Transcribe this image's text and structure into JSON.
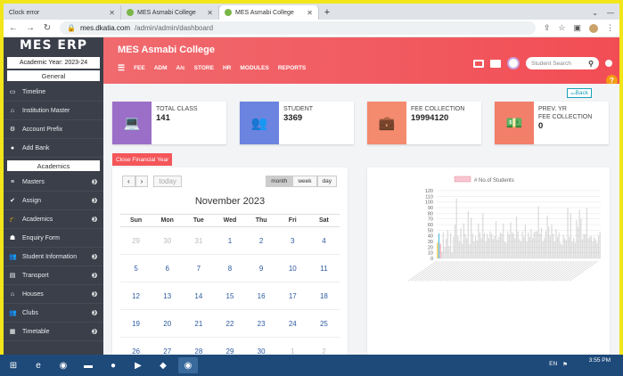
{
  "browser": {
    "tabs": [
      {
        "label": "Clock error",
        "active": false
      },
      {
        "label": "MES Asmabi College",
        "active": false
      },
      {
        "label": "MES Asmabi College",
        "active": true
      }
    ],
    "url_host": "mes.dkatia.com",
    "url_path": "/admin/admin/dashboard"
  },
  "sidebar": {
    "brand": "MES ERP",
    "academic_year": "Academic Year: 2023-24",
    "general_header": "General",
    "general_items": [
      {
        "label": "Timeline",
        "icon": "monitor-icon",
        "arrow": false
      },
      {
        "label": "Institution Master",
        "icon": "bank-icon",
        "arrow": false
      },
      {
        "label": "Account Prefix",
        "icon": "gears-icon",
        "arrow": false
      },
      {
        "label": "Add Bank",
        "icon": "dot-icon",
        "arrow": false
      }
    ],
    "academics_header": "Academics",
    "academics_items": [
      {
        "label": "Masters",
        "icon": "list-icon",
        "arrow": true
      },
      {
        "label": "Assign",
        "icon": "check-icon",
        "arrow": true
      },
      {
        "label": "Academics",
        "icon": "graduation-icon",
        "arrow": true
      },
      {
        "label": "Enquiry Form",
        "icon": "user-icon",
        "arrow": false
      },
      {
        "label": "Student Information",
        "icon": "users-icon",
        "arrow": true
      },
      {
        "label": "Transport",
        "icon": "bus-icon",
        "arrow": true
      },
      {
        "label": "Houses",
        "icon": "home-icon",
        "arrow": true
      },
      {
        "label": "Clubs",
        "icon": "users-icon",
        "arrow": true
      },
      {
        "label": "Timetable",
        "icon": "table-icon",
        "arrow": true
      }
    ]
  },
  "header": {
    "title": "MES Asmabi College",
    "menu": [
      "FEE",
      "ADM",
      "A/c",
      "STORE",
      "HR",
      "MODULES",
      "REPORTS"
    ],
    "search_placeholder": "Student Search"
  },
  "back_label": "Back",
  "cards": [
    {
      "label": "TOTAL CLASS",
      "value": "141",
      "color": "#9b6fc8",
      "icon": "laptop-icon"
    },
    {
      "label": "STUDENT",
      "value": "3369",
      "color": "#6b84e0",
      "icon": "users-icon"
    },
    {
      "label": "FEE COLLECTION",
      "value": "19994120",
      "color": "#f48a6e",
      "icon": "briefcase-icon"
    },
    {
      "label": "PREV. YR",
      "label2": "FEE COLLECTION",
      "value": "0",
      "color": "#f27f6a",
      "icon": "money-icon"
    }
  ],
  "close_fy": "Close Financial Year",
  "calendar": {
    "prev": "‹",
    "next": "›",
    "today": "today",
    "views": [
      "month",
      "week",
      "day"
    ],
    "title": "November 2023",
    "daynames": [
      "Sun",
      "Mon",
      "Tue",
      "Wed",
      "Thu",
      "Fri",
      "Sat"
    ],
    "days": [
      [
        "29",
        1
      ],
      [
        "30",
        1
      ],
      [
        "31",
        1
      ],
      [
        "1",
        0
      ],
      [
        "2",
        0
      ],
      [
        "3",
        0
      ],
      [
        "4",
        0
      ],
      [
        "5",
        0
      ],
      [
        "6",
        0
      ],
      [
        "7",
        0
      ],
      [
        "8",
        0
      ],
      [
        "9",
        0
      ],
      [
        "10",
        0
      ],
      [
        "11",
        0
      ],
      [
        "12",
        0
      ],
      [
        "13",
        0
      ],
      [
        "14",
        0
      ],
      [
        "15",
        0
      ],
      [
        "16",
        0
      ],
      [
        "17",
        0
      ],
      [
        "18",
        0
      ],
      [
        "19",
        0
      ],
      [
        "20",
        0
      ],
      [
        "21",
        0
      ],
      [
        "22",
        0
      ],
      [
        "23",
        0
      ],
      [
        "24",
        0
      ],
      [
        "25",
        0
      ],
      [
        "26",
        0
      ],
      [
        "27",
        0
      ],
      [
        "28",
        0
      ],
      [
        "29",
        0
      ],
      [
        "30",
        0
      ],
      [
        "1",
        1
      ],
      [
        "2",
        1
      ]
    ]
  },
  "chart_data": {
    "type": "bar",
    "title": "",
    "series": [
      {
        "name": "# No.of Students",
        "values": [
          28,
          44,
          26,
          12,
          46,
          20,
          35,
          50,
          22,
          45,
          10,
          38,
          60,
          106,
          40,
          30,
          54,
          26,
          62,
          44,
          36,
          84,
          25,
          72,
          44,
          30,
          40,
          32,
          62,
          46,
          36,
          80,
          45,
          30,
          44,
          36,
          48,
          44,
          34,
          40,
          66,
          33,
          38,
          46,
          44,
          62,
          30,
          28,
          48,
          42,
          64,
          46,
          44,
          36,
          74,
          48,
          34,
          30,
          48,
          38,
          60,
          30,
          46,
          38,
          52,
          36,
          46,
          48,
          48,
          92,
          44,
          54,
          30,
          36,
          48,
          76,
          56,
          40,
          60,
          44,
          30,
          52,
          38,
          46,
          28,
          24,
          42,
          36,
          32,
          90,
          38,
          80,
          30,
          36,
          28,
          68,
          56,
          86,
          70,
          34,
          44,
          42,
          90,
          36,
          38,
          40,
          30,
          38,
          34,
          28,
          40,
          46
        ]
      }
    ],
    "highlight_colors": [
      "#f5c542",
      "#5bc0de",
      "#f0a0b0"
    ],
    "ylim": [
      0,
      120
    ],
    "yticks": [
      0,
      10,
      20,
      30,
      40,
      50,
      60,
      70,
      80,
      90,
      100,
      110,
      120
    ],
    "legend": "top",
    "grid": true
  },
  "taskbar": {
    "lang": "EN",
    "time": "3:55 PM"
  }
}
